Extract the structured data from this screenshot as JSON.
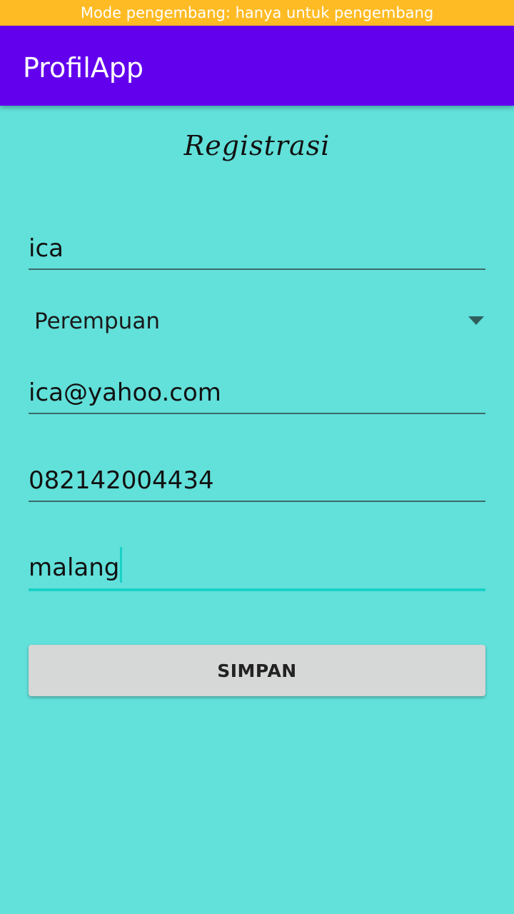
{
  "status_banner": {
    "text": "Mode pengembang: hanya untuk pengembang"
  },
  "app_bar": {
    "title": "ProfilApp"
  },
  "form": {
    "title": "Registrasi",
    "name_value": "ica",
    "gender_selected": "Perempuan",
    "email_value": "ica@yahoo.com",
    "phone_value": "082142004434",
    "city_value": "malang",
    "submit_label": "SIMPAN"
  },
  "colors": {
    "banner": "#ffbb24",
    "app_bar": "#6200ee",
    "background": "#62e0da",
    "focus_accent": "#18d3c6",
    "button": "#d6d7d7"
  },
  "icons": {
    "spinner_arrow": "chevron-down-icon"
  }
}
